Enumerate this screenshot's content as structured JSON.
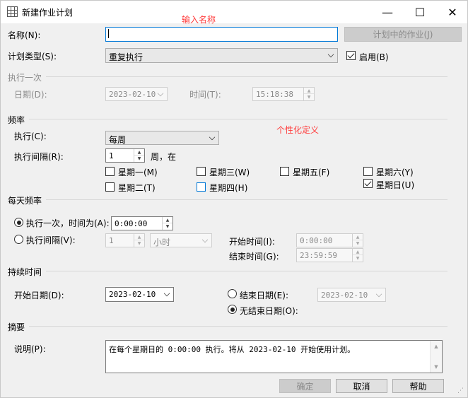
{
  "window": {
    "title": "新建作业计划",
    "minimize_glyph": "—",
    "maximize_glyph": "☐",
    "close_glyph": "✕"
  },
  "annotations": {
    "name_hint": "输入名称",
    "custom_hint": "个性化定义"
  },
  "general": {
    "name_label": "名称(N):",
    "name_value": "",
    "jobs_in_schedule_button": "计划中的作业(J)",
    "schedule_type_label": "计划类型(S):",
    "schedule_type_value": "重复执行",
    "enabled_label": "启用(B)",
    "enabled_checked": true
  },
  "one_time": {
    "section": "执行一次",
    "date_label": "日期(D):",
    "date_value": "2023-02-10",
    "time_label": "时间(T):",
    "time_value": "15:18:38"
  },
  "frequency": {
    "section": "频率",
    "occurs_label": "执行(C):",
    "occurs_value": "每周",
    "recurs_label": "执行间隔(R):",
    "recurs_value": "1",
    "recurs_suffix": "周，在",
    "days": {
      "monday": "星期一(M)",
      "tuesday": "星期二(T)",
      "wednesday": "星期三(W)",
      "thursday": "星期四(H)",
      "friday": "星期五(F)",
      "saturday": "星期六(Y)",
      "sunday": "星期日(U)"
    },
    "checked_days": [
      "sunday"
    ]
  },
  "daily_frequency": {
    "section": "每天频率",
    "once_label": "执行一次，时间为(A):",
    "once_value": "0:00:00",
    "once_selected": true,
    "every_label": "执行间隔(V):",
    "every_value": "1",
    "every_unit": "小时",
    "start_label": "开始时间(I):",
    "start_value": "0:00:00",
    "end_label": "结束时间(G):",
    "end_value": "23:59:59"
  },
  "duration": {
    "section": "持续时间",
    "start_date_label": "开始日期(D):",
    "start_date_value": "2023-02-10",
    "end_date_label": "结束日期(E):",
    "end_date_value": "2023-02-10",
    "no_end_label": "无结束日期(O):",
    "no_end_selected": true
  },
  "summary": {
    "section": "摘要",
    "description_label": "说明(P):",
    "description_value": "在每个星期日的 0:00:00 执行。将从 2023-02-10 开始使用计划。"
  },
  "buttons": {
    "ok": "确定",
    "cancel": "取消",
    "help": "帮助"
  }
}
